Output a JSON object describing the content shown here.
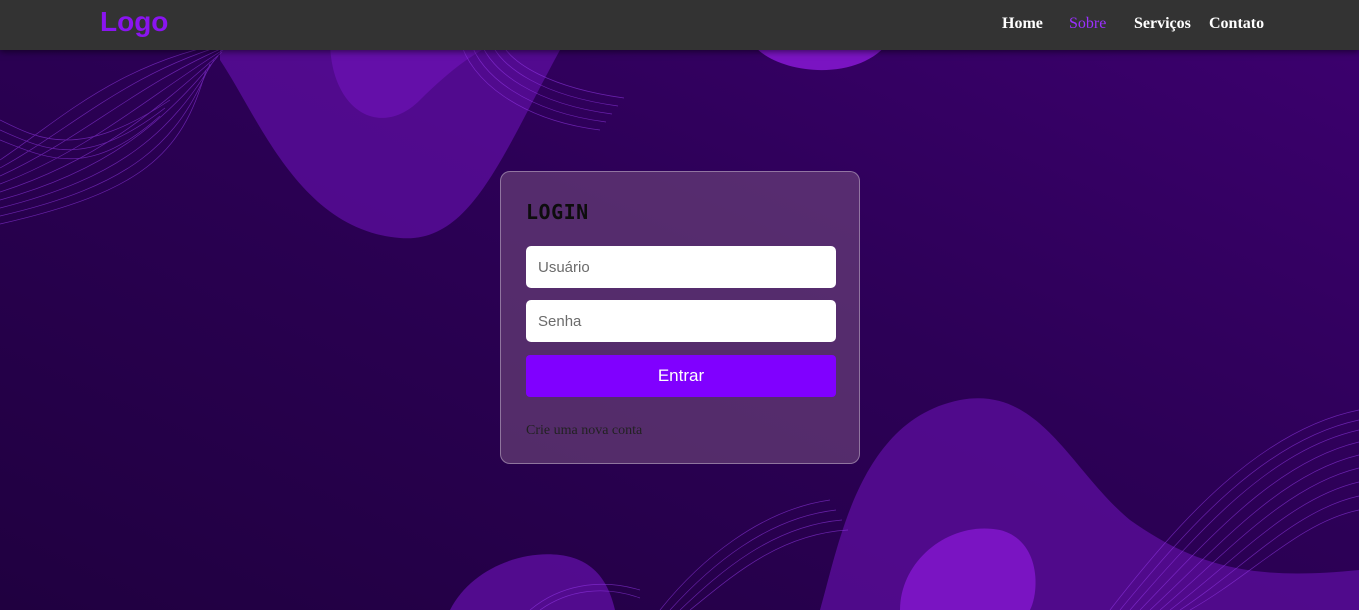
{
  "header": {
    "logo": "Logo",
    "nav": [
      {
        "label": "Home",
        "active": false
      },
      {
        "label": "Sobre",
        "active": true
      },
      {
        "label": "Serviços",
        "active": false
      },
      {
        "label": "Contato",
        "active": false
      }
    ]
  },
  "login": {
    "title": "LOGIN",
    "username_placeholder": "Usuário",
    "password_placeholder": "Senha",
    "submit_label": "Entrar",
    "create_account_link": "Crie uma nova conta"
  },
  "colors": {
    "accent": "#8000ff",
    "logo": "#8a14f0",
    "active_nav": "#9b30ff",
    "header_bg": "#333333",
    "background": "#2a004f"
  }
}
